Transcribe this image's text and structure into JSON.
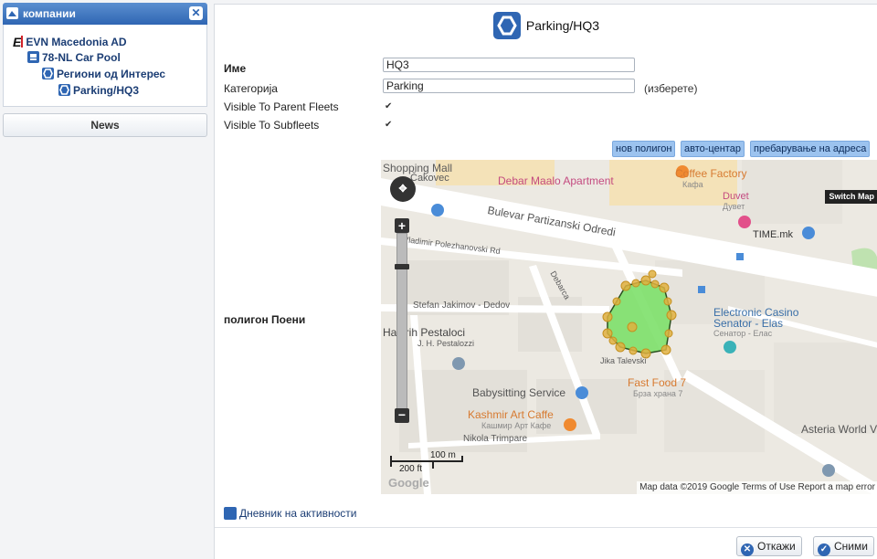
{
  "sidebar": {
    "title": "компании",
    "tree": [
      {
        "label": "EVN Macedonia AD",
        "logo": "E"
      },
      {
        "label": "78-NL Car Pool"
      },
      {
        "label": "Региони од Интерес"
      },
      {
        "label": "Parking/HQ3"
      }
    ],
    "news_label": "News"
  },
  "main": {
    "title": "Parking/HQ3",
    "fields": {
      "name_label": "Име",
      "name_value": "HQ3",
      "category_label": "Категорија",
      "category_value": "Parking",
      "choose_label": "(изберете)",
      "visible_parent_label": "Visible To Parent Fleets",
      "visible_sub_label": "Visible To Subfleets",
      "polygon_label": "полигон Поени"
    },
    "map_buttons": [
      "нов полигон",
      "авто-центар",
      "пребарување на адреса"
    ],
    "map": {
      "switch_label": "Switch Map",
      "credit": "Map data ©2019 Google   Terms of Use   Report a map error",
      "scale_m": "100 m",
      "scale_ft": "200 ft",
      "labels": {
        "shopping": "Shopping Mall",
        "shopping2": "Čakovec",
        "debar_maalo": "Debar Maalo Apartment",
        "coffee": "Coffee Factory",
        "coffee_sub": "Кафа",
        "duvet": "Duvet",
        "duvet_sub": "Дувет",
        "time": "TIME.mk",
        "bulevar": "Bulevar Partizanski Odredi",
        "vladimir": "Vladimir Polezhanovski Rd",
        "debarca": "Debarca",
        "stefan": "Stefan Jakimov - Dedov",
        "pestaloci": "Hajnrih Pestaloci",
        "pestaloci_sub": "J. H. Pestalozzi",
        "casino": "Electronic Casino",
        "casino2": "Senator - Elas",
        "casino_sub": "Сенатор - Елас",
        "talevski": "Jika Talevski",
        "fastfood": "Fast Food 7",
        "fastfood_sub": "Брза храна 7",
        "babysitting": "Babysitting Service",
        "kashmir": "Kashmir Art Caffe",
        "kashmir_sub": "Кашмир Арт Кафе",
        "nikola": "Nikola Trimpare",
        "asteria": "Asteria World V",
        "google": "Google"
      }
    },
    "activity_label": "Дневник на активности",
    "buttons": {
      "cancel": "Откажи",
      "save": "Сними"
    }
  },
  "colors": {
    "accent": "#2f66b3",
    "polygon_fill": "#7de06a",
    "polygon_vertex": "#e0b040"
  }
}
